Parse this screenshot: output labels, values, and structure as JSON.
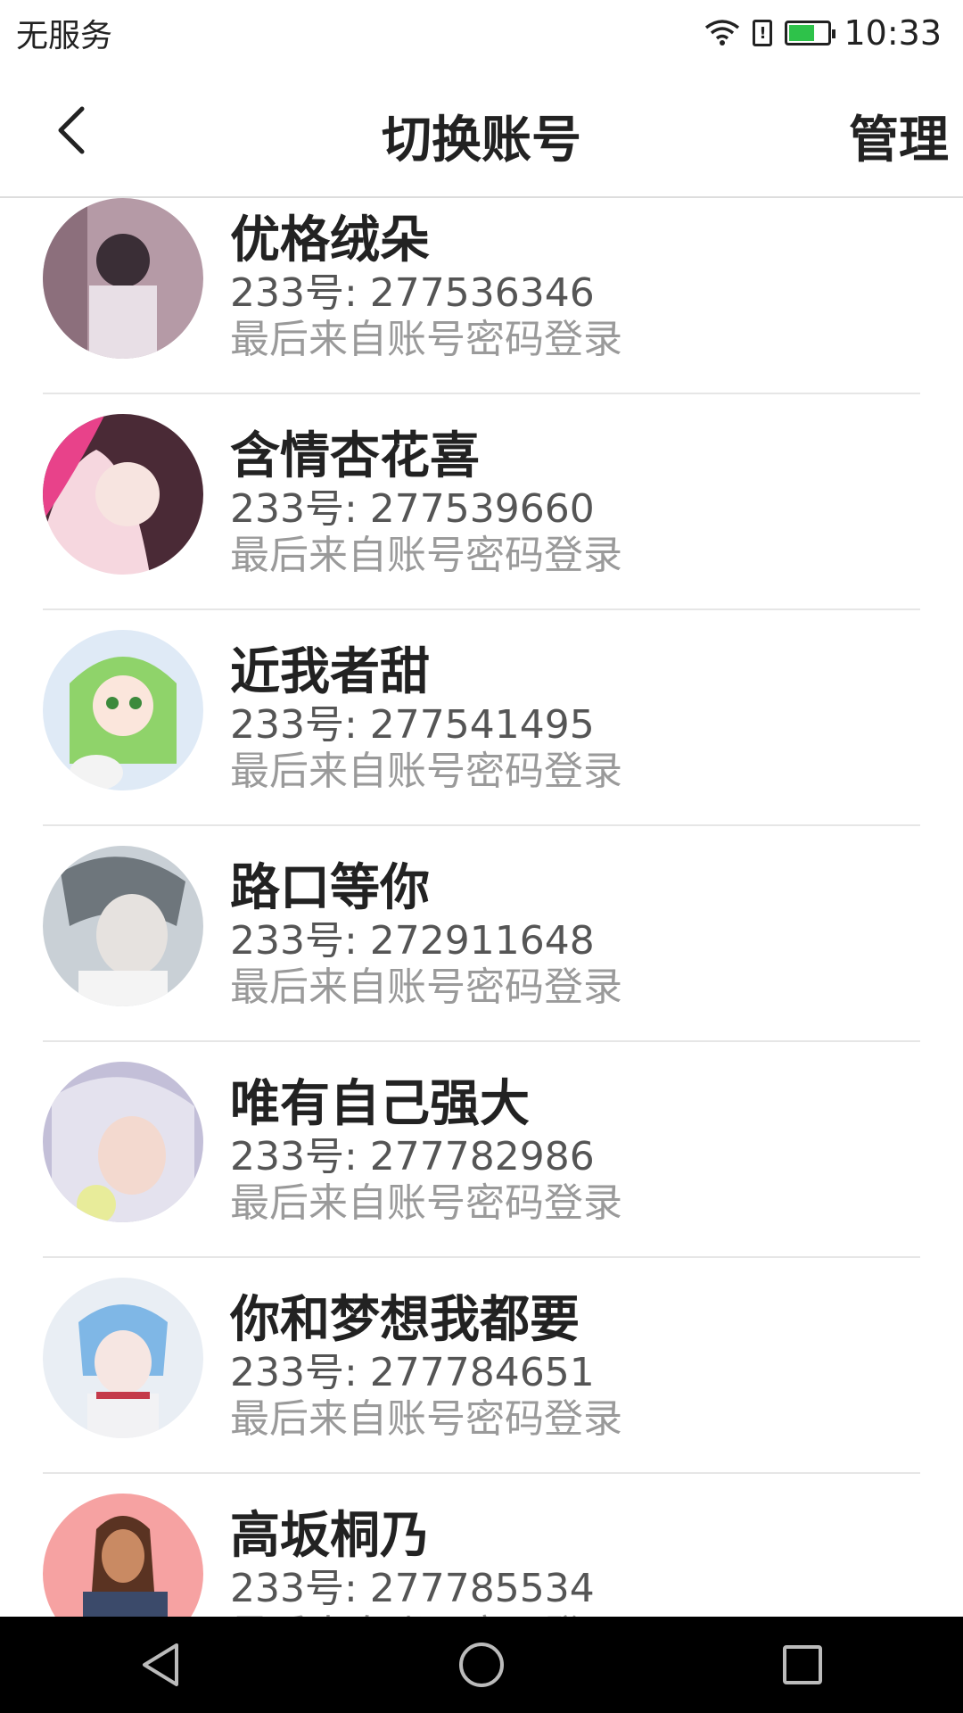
{
  "status_bar": {
    "carrier": "无服务",
    "time": "10:33",
    "icons": [
      "wifi-icon",
      "alert-icon",
      "battery-icon"
    ],
    "battery_color": "#2ec24a"
  },
  "header": {
    "title": "切换账号",
    "manage_label": "管理",
    "back_icon": "chevron-left-icon"
  },
  "accounts": [
    {
      "name": "优格绒朵",
      "uid": "233号: 277536346",
      "login": "最后来自账号密码登录",
      "avatar_bg": "#9b7e8a"
    },
    {
      "name": "含情杏花喜",
      "uid": "233号: 277539660",
      "login": "最后来自账号密码登录",
      "avatar_bg": "#c24f7a"
    },
    {
      "name": "近我者甜",
      "uid": "233号: 277541495",
      "login": "最后来自账号密码登录",
      "avatar_bg": "#8fd36a"
    },
    {
      "name": "路口等你",
      "uid": "233号: 272911648",
      "login": "最后来自账号密码登录",
      "avatar_bg": "#9fa7ad"
    },
    {
      "name": "唯有自己强大",
      "uid": "233号: 277782986",
      "login": "最后来自账号密码登录",
      "avatar_bg": "#b6b2cf"
    },
    {
      "name": "你和梦想我都要",
      "uid": "233号: 277784651",
      "login": "最后来自账号密码登录",
      "avatar_bg": "#b9d2ea"
    },
    {
      "name": "高坂桐乃",
      "uid": "233号: 277785534",
      "login": "最后来自账号密码登录",
      "avatar_bg": "#f39b9b"
    }
  ],
  "nav_bar": {
    "back_icon": "triangle-back-icon",
    "home_icon": "circle-home-icon",
    "recents_icon": "square-recents-icon"
  }
}
